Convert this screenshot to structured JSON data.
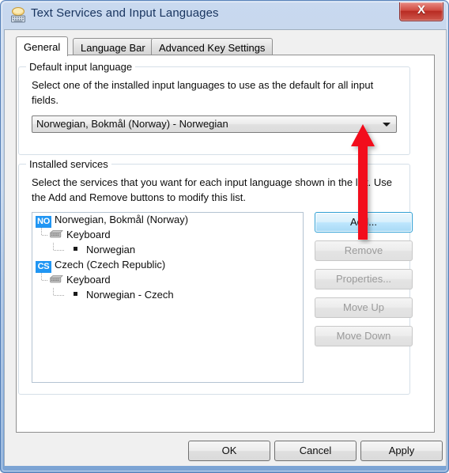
{
  "window": {
    "title": "Text Services and Input Languages",
    "icon": "keyboard-language-icon",
    "ghost_text": "",
    "close_label": "X",
    "frame_color": "#7ba3d4",
    "close_color": "#b82a22"
  },
  "tabs": [
    {
      "label": "General",
      "active": true
    },
    {
      "label": "Language Bar",
      "active": false
    },
    {
      "label": "Advanced Key Settings",
      "active": false
    }
  ],
  "default_input_language": {
    "group_title": "Default input language",
    "description": "Select one of the installed input languages to use as the default for all input fields.",
    "combo": {
      "value": "Norwegian, Bokmål (Norway) - Norwegian",
      "arrow_icon": "chevron-down-icon"
    }
  },
  "installed_services": {
    "group_title": "Installed services",
    "description": "Select the services that you want for each input language shown in the list. Use the Add and Remove buttons to modify this list.",
    "tree": [
      {
        "level": 0,
        "badge": "NO",
        "label": "Norwegian, Bokmål (Norway)",
        "icon": "language-badge-icon"
      },
      {
        "level": 1,
        "badge": "",
        "label": "Keyboard",
        "icon": "keyboard-icon"
      },
      {
        "level": 2,
        "badge": "",
        "label": "Norwegian",
        "icon": "bullet-square-icon"
      },
      {
        "level": 0,
        "badge": "CS",
        "label": "Czech (Czech Republic)",
        "icon": "language-badge-icon"
      },
      {
        "level": 1,
        "badge": "",
        "label": "Keyboard",
        "icon": "keyboard-icon"
      },
      {
        "level": 2,
        "badge": "",
        "label": "Norwegian - Czech",
        "icon": "bullet-square-icon"
      }
    ],
    "badge_color": "#2196f3",
    "buttons": [
      {
        "label": "Add...",
        "state": "focused"
      },
      {
        "label": "Remove",
        "state": "disabled"
      },
      {
        "label": "Properties...",
        "state": "disabled"
      },
      {
        "label": "Move Up",
        "state": "disabled"
      },
      {
        "label": "Move Down",
        "state": "disabled"
      }
    ]
  },
  "dialog_buttons": {
    "ok": "OK",
    "cancel": "Cancel",
    "apply": "Apply"
  },
  "annotation": {
    "type": "arrow-up",
    "color": "#f20d1e",
    "points_to": "default-input-language-combo"
  }
}
